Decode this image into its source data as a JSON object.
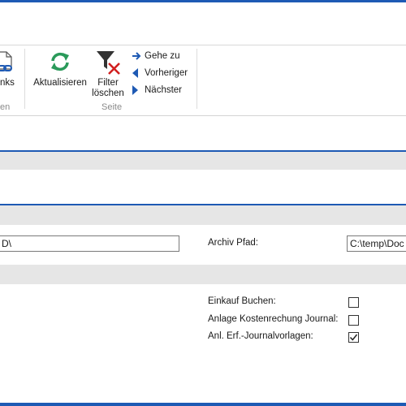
{
  "ribbon": {
    "links_button": {
      "label": "nks",
      "icon": "link-document-icon"
    },
    "group1_caption": "en",
    "refresh_button": {
      "label": "Aktualisieren",
      "icon": "refresh-icon"
    },
    "filter_button": {
      "label_line1": "Filter",
      "label_line2": "löschen",
      "icon": "clear-filter-icon"
    },
    "goto": {
      "label": "Gehe zu",
      "icon": "arrow-right-icon"
    },
    "previous": {
      "label": "Vorheriger",
      "icon": "triangle-left-icon"
    },
    "next": {
      "label": "Nächster",
      "icon": "triangle-right-icon"
    },
    "page_group_caption": "Seite"
  },
  "form": {
    "path_field": {
      "value": "D\\"
    },
    "archive_path": {
      "label": "Archiv Pfad:",
      "value": "C:\\temp\\Doc"
    },
    "checkboxes": [
      {
        "label": "Einkauf Buchen:",
        "checked": false
      },
      {
        "label": "Anlage Kostenrechung Journal:",
        "checked": false
      },
      {
        "label": "Anl. Erf.-Journalvorlagen:",
        "checked": true
      }
    ]
  },
  "colors": {
    "accent": "#1e5ab4",
    "band": "#e6e6e6",
    "refresh_green": "#2a9a5a",
    "filter_red": "#d11f1f",
    "nav_blue": "#1e5ab4"
  }
}
